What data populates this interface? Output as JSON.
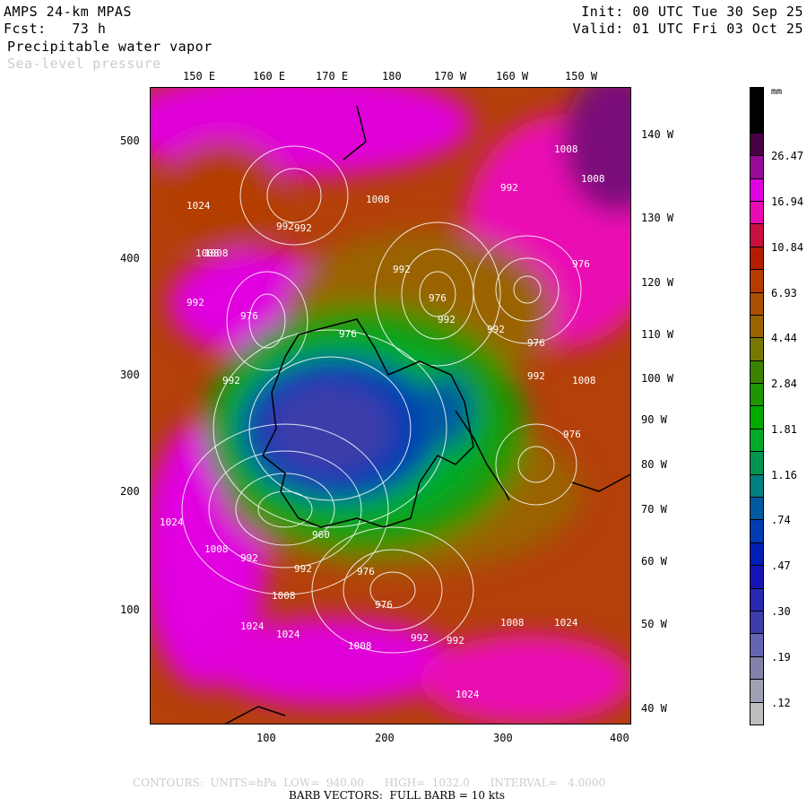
{
  "header": {
    "model": "AMPS 24-km MPAS",
    "forecast": "Fcst:   73 h",
    "init": "Init: 00 UTC Tue 30 Sep 25",
    "valid": "Valid: 01 UTC Fri 03 Oct 25",
    "field_primary": "Precipitable water vapor",
    "field_secondary": "Sea-level pressure"
  },
  "axes": {
    "top_lon": [
      "150 E",
      "160 E",
      "170 E",
      "180",
      "170 W",
      "160 W",
      "150 W"
    ],
    "right_lon": [
      "140 W",
      "130 W",
      "120 W",
      "110 W",
      "100 W",
      "90 W",
      "80 W",
      "70 W",
      "60 W",
      "50 W",
      "40 W"
    ],
    "y_ticks": [
      "500",
      "400",
      "300",
      "200",
      "100"
    ],
    "x_ticks": [
      "100",
      "200",
      "300",
      "400"
    ]
  },
  "pressure_labels": [
    "1024",
    "1008",
    "992",
    "976",
    "992",
    "1008",
    "992",
    "1008",
    "992",
    "976",
    "992",
    "976",
    "1008",
    "992",
    "992",
    "976",
    "992",
    "976",
    "1024",
    "1008",
    "992",
    "960",
    "992",
    "976",
    "1008",
    "1024",
    "1024",
    "1008",
    "1008",
    "992",
    "976",
    "992",
    "1024",
    "1008",
    "1024",
    "992",
    "1008",
    "976"
  ],
  "colorbar": {
    "units": "mm",
    "labels": [
      "26.47",
      "16.94",
      "10.84",
      "6.93",
      "4.44",
      "2.84",
      "1.81",
      "1.16",
      ".74",
      ".47",
      ".30",
      ".19",
      ".12"
    ],
    "colors": [
      "#000000",
      "#000000",
      "#4a0045",
      "#9a0a9a",
      "#e000e0",
      "#ea0ab4",
      "#c81040",
      "#b41e00",
      "#b43c00",
      "#aa5000",
      "#9a6400",
      "#787800",
      "#3c8200",
      "#1e9600",
      "#00aa00",
      "#00aa28",
      "#009650",
      "#008080",
      "#005aa0",
      "#003cb4",
      "#001eb4",
      "#1414b4",
      "#2828b4",
      "#3c3caa",
      "#6464b4",
      "#8282aa",
      "#a0a0b4",
      "#bebebe"
    ]
  },
  "footer": {
    "contours": "CONTOURS:  UNITS=hPa  LOW=  940.00      HIGH=  1032.0      INTERVAL=   4.0000",
    "barbs": "BARB VECTORS:  FULL BARB = 10 kts"
  }
}
